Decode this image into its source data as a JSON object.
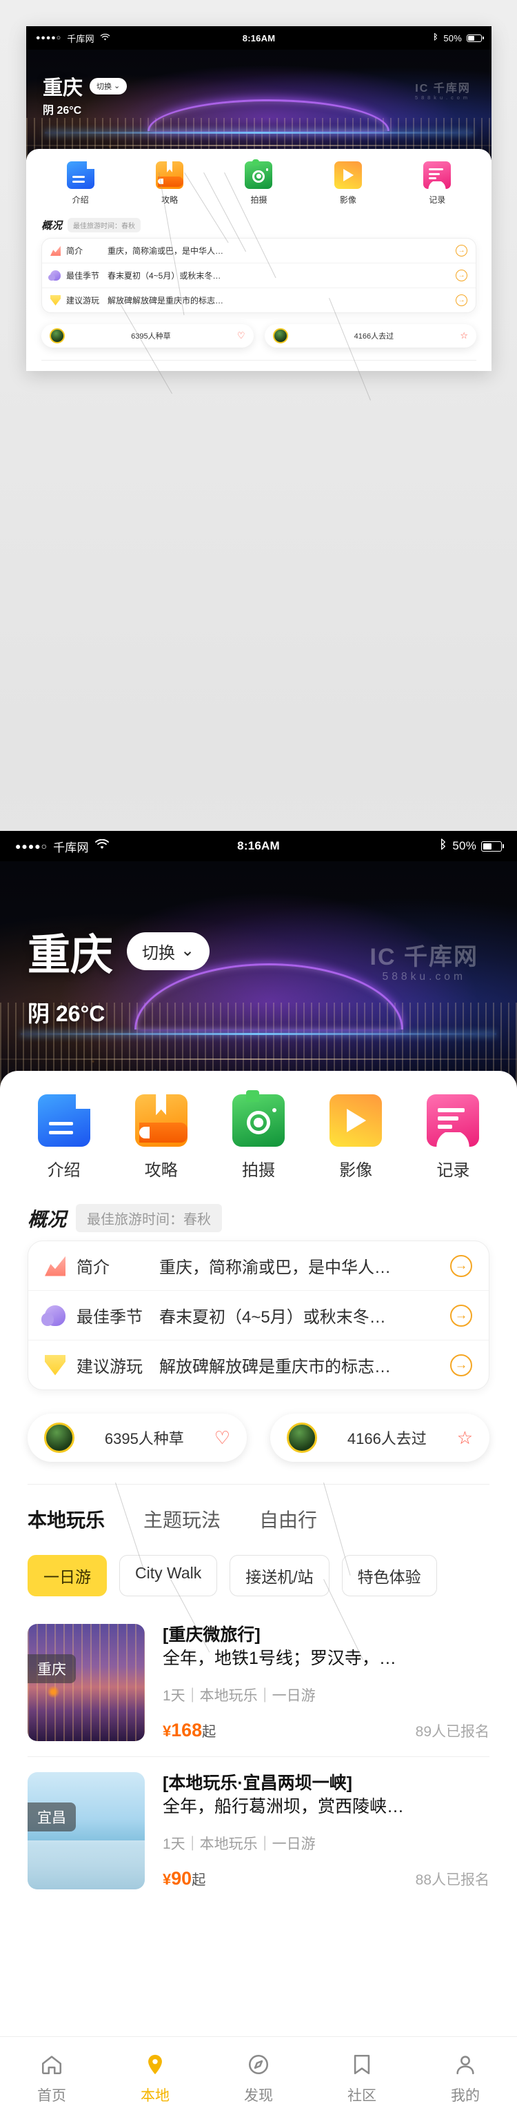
{
  "status_bar": {
    "signal_dots": "●●●●○",
    "carrier": "千库网",
    "wifi_icon": "wifi-icon",
    "time": "8:16AM",
    "bluetooth_icon": "bluetooth-icon",
    "battery_percent": "50%"
  },
  "hero": {
    "city": "重庆",
    "switch_label": "切换",
    "chevron": "⌄",
    "weather": "阴 26°C",
    "watermark": "IC 千库网",
    "watermark_sub": "588ku.com"
  },
  "quick_nav": [
    {
      "label": "介绍",
      "icon": "document-icon",
      "color": "#2563f0"
    },
    {
      "label": "攻略",
      "icon": "book-icon",
      "color": "#ff8a00"
    },
    {
      "label": "拍摄",
      "icon": "camera-icon",
      "color": "#11943a"
    },
    {
      "label": "影像",
      "icon": "play-icon",
      "color": "#ffc02e"
    },
    {
      "label": "记录",
      "icon": "list-icon",
      "color": "#ec1f78"
    }
  ],
  "overview": {
    "title": "概况",
    "tag": "最佳旅游时间：春秋",
    "rows": [
      {
        "icon": "chart-icon",
        "key": "简介",
        "value": "重庆，简称渝或巴，是中华人…",
        "arrow": "→"
      },
      {
        "icon": "cloud-icon",
        "key": "最佳季节",
        "value": "春末夏初（4~5月）或秋末冬…",
        "arrow": "→"
      },
      {
        "icon": "mail-icon",
        "key": "建议游玩",
        "value": "解放碑解放碑是重庆市的标志…",
        "arrow": "→"
      }
    ]
  },
  "stats": [
    {
      "avatar": "avatar-icon",
      "text": "6395人种草",
      "icon": "heart-icon",
      "glyph": "♡"
    },
    {
      "avatar": "avatar-icon",
      "text": "4166人去过",
      "icon": "star-icon",
      "glyph": "☆"
    }
  ],
  "tabs": [
    {
      "label": "本地玩乐",
      "active": true
    },
    {
      "label": "主题玩法",
      "active": false
    },
    {
      "label": "自由行",
      "active": false
    }
  ],
  "chips": [
    {
      "label": "一日游",
      "selected": true
    },
    {
      "label": "City Walk",
      "selected": false
    },
    {
      "label": "接送机/站",
      "selected": false
    },
    {
      "label": "特色体验",
      "selected": false
    }
  ],
  "products": [
    {
      "badge": "重庆",
      "title": "[重庆微旅行]",
      "desc": "全年，地铁1号线；罗汉寺，…",
      "meta": "1天｜本地玩乐｜一日游",
      "currency": "¥",
      "price": "168",
      "price_suffix": "起",
      "joined": "89人已报名",
      "thumb": "chongqing-skyline-thumb"
    },
    {
      "badge": "宜昌",
      "title": "[本地玩乐·宜昌两坝一峡]",
      "desc": "全年，船行葛洲坝，赏西陵峡…",
      "meta": "1天｜本地玩乐｜一日游",
      "currency": "¥",
      "price": "90",
      "price_suffix": "起",
      "joined": "88人已报名",
      "thumb": "yichang-river-thumb"
    }
  ],
  "bottom_nav": [
    {
      "label": "首页",
      "icon": "home-icon",
      "glyph": "⌂",
      "active": false
    },
    {
      "label": "本地",
      "icon": "location-pin-icon",
      "glyph": "◉",
      "active": true
    },
    {
      "label": "发现",
      "icon": "compass-icon",
      "glyph": "◈",
      "active": false
    },
    {
      "label": "社区",
      "icon": "bookmark-icon",
      "glyph": "▣",
      "active": false
    },
    {
      "label": "我的",
      "icon": "user-icon",
      "glyph": "☻",
      "active": false
    }
  ],
  "watermark": {
    "main": "IC 千库网",
    "sub": "588ku.com"
  },
  "theme": {
    "accent_yellow": "#ffd83a",
    "accent_orange": "#ff6a00",
    "arrow_orange": "#f5a623",
    "nav_active": "#f5b500"
  }
}
